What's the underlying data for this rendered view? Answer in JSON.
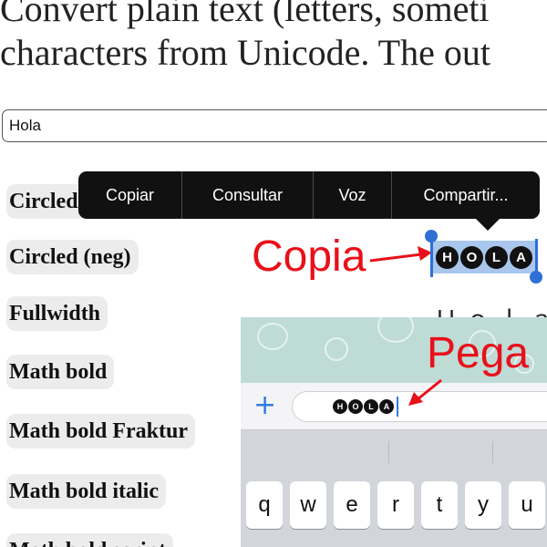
{
  "intro": {
    "line1": "Convert plain text (letters, someti",
    "line2": "characters from Unicode. The out"
  },
  "input": {
    "value": "Hola"
  },
  "styles": [
    {
      "label": "Circled"
    },
    {
      "label": "Circled (neg)"
    },
    {
      "label": "Fullwidth"
    },
    {
      "label": "Math bold"
    },
    {
      "label": "Math bold Fraktur"
    },
    {
      "label": "Math bold italic"
    },
    {
      "label": "Math bold script"
    }
  ],
  "context_menu": {
    "items": [
      "Copiar",
      "Consultar",
      "Voz",
      "Compartir..."
    ]
  },
  "annotations": {
    "copy": "Copia",
    "paste": "Pega"
  },
  "output_circled_neg": [
    "H",
    "O",
    "L",
    "A"
  ],
  "output_fullwidth": "Ｈｏｌａ",
  "chat": {
    "pasted_letters": [
      "H",
      "O",
      "L",
      "A"
    ],
    "keyboard_row": [
      "q",
      "w",
      "e",
      "r",
      "t",
      "y",
      "u"
    ]
  },
  "colors": {
    "annotation_red": "#e8101a",
    "selection_blue": "#a9c6ec",
    "ios_blue": "#2f7be0",
    "menu_black": "#111111"
  }
}
